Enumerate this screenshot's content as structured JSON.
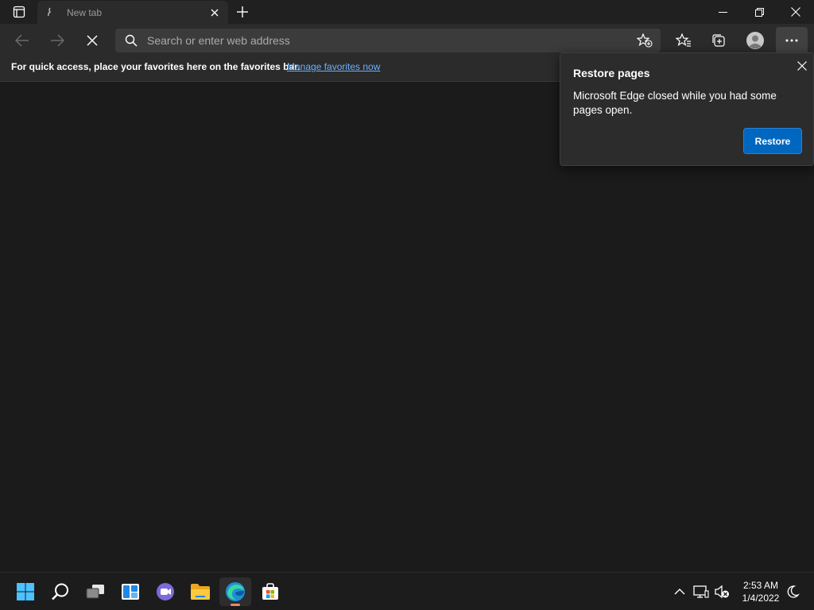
{
  "window": {
    "tab_title": "New tab",
    "tab_favicon": "loading-icon"
  },
  "toolbar": {
    "address_placeholder": "Search or enter web address",
    "address_value": ""
  },
  "favorites_bar": {
    "message": "For quick access, place your favorites here on the favorites bar.",
    "link_label": "Manage favorites now"
  },
  "restore_popup": {
    "title": "Restore pages",
    "message": "Microsoft Edge closed while you had some pages open.",
    "button_label": "Restore"
  },
  "taskbar": {
    "apps": [
      "start-icon",
      "search-icon",
      "task-view-icon",
      "widgets-icon",
      "chat-icon",
      "file-explorer-icon",
      "edge-icon",
      "store-icon"
    ],
    "active_app": "edge-icon",
    "clock_time": "2:53 AM",
    "clock_date": "1/4/2022"
  },
  "colors": {
    "accent": "#0067c0",
    "link": "#6cb0ff",
    "background": "#1b1b1b",
    "toolbar": "#2b2b2b",
    "active_indicator": "#e5896a"
  }
}
